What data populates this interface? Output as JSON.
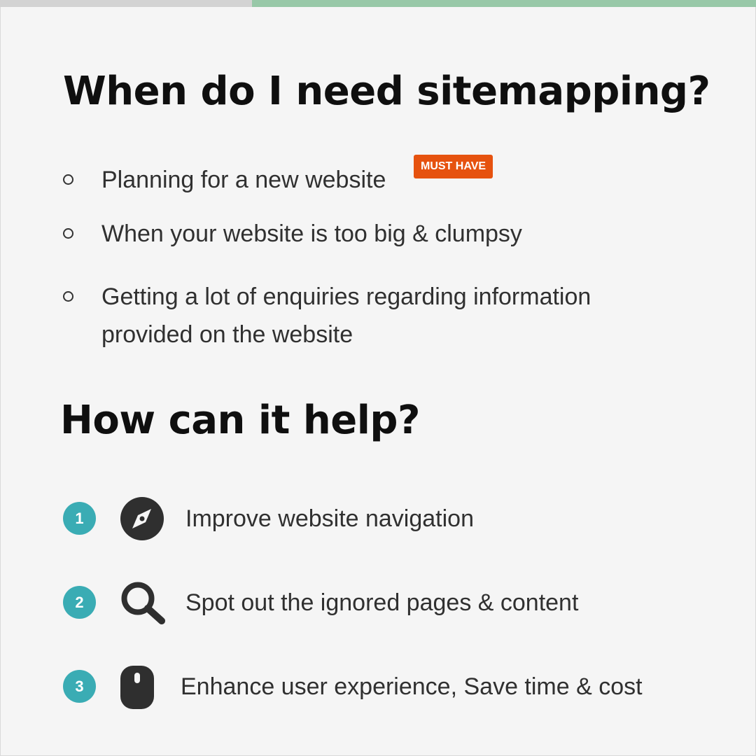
{
  "progress": {
    "fraction": 0.667
  },
  "section1": {
    "title": "When do I need sitemapping?",
    "items": [
      {
        "text": "Planning for a new website",
        "badge": "MUST HAVE"
      },
      {
        "text": "When your website is too big & clumpsy"
      },
      {
        "text": "Getting a lot of enquiries regarding information provided on the website"
      }
    ]
  },
  "section2": {
    "title": "How can it help?",
    "items": [
      {
        "number": "1",
        "icon": "compass-icon",
        "text": "Improve website navigation"
      },
      {
        "number": "2",
        "icon": "search-icon",
        "text": "Spot out the ignored pages & content"
      },
      {
        "number": "3",
        "icon": "mouse-icon",
        "text": "Enhance user experience, Save time & cost"
      }
    ]
  },
  "colors": {
    "accent_teal": "#3aacb4",
    "badge_orange": "#e6520f",
    "progress_green": "#98c8a8",
    "progress_track": "#d3d3d3",
    "icon_dark": "#2f2f2f"
  }
}
